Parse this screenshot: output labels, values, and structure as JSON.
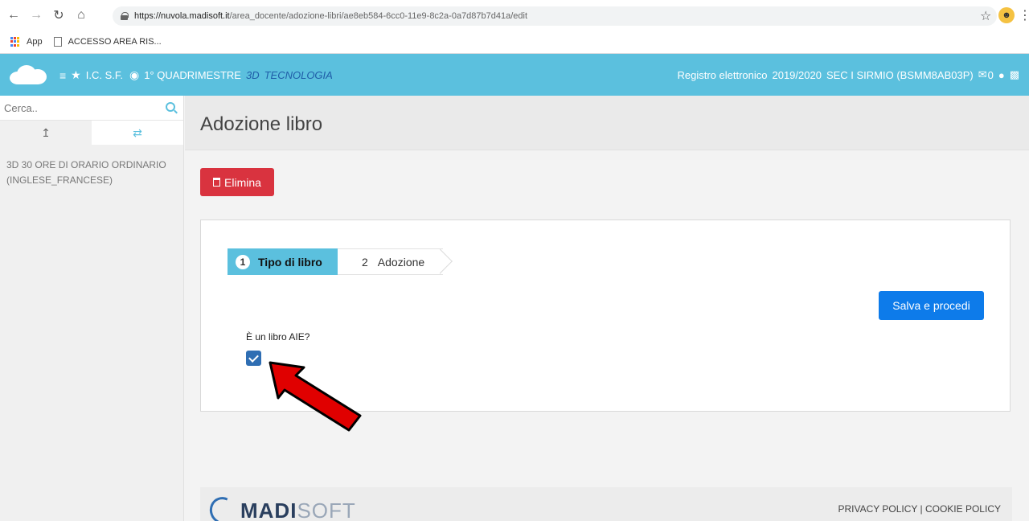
{
  "browser": {
    "url_host": "https://nuvola.madisoft.it",
    "url_path": "/area_docente/adozione-libri/ae8eb584-6cc0-11e9-8c2a-0a7d87b7d41a/edit",
    "bookmarks": [
      "App",
      "ACCESSO AREA RIS..."
    ]
  },
  "header": {
    "school": "I.C. S.F.",
    "period": "1° QUADRIMESTRE",
    "class": "3D",
    "subject": "TECNOLOGIA",
    "registro": "Registro elettronico",
    "year": "2019/2020",
    "sede": "SEC I SIRMIO (BSMM8AB03P)",
    "messages": "0"
  },
  "sidebar": {
    "search_placeholder": "Cerca..",
    "item": "3D 30 ORE DI ORARIO ORDINARIO (INGLESE_FRANCESE)"
  },
  "main": {
    "title": "Adozione libro",
    "delete_label": "Elimina",
    "steps": [
      {
        "num": "1",
        "label": "Tipo di libro"
      },
      {
        "num": "2",
        "label": "Adozione"
      }
    ],
    "save_label": "Salva e procedi",
    "aie_question": "È un libro AIE?"
  },
  "footer": {
    "logo_bold": "MADI",
    "logo_light": "SOFT",
    "links": "PRIVACY POLICY | COOKIE POLICY"
  },
  "colors": {
    "header_bg": "#5bc0de",
    "danger": "#d9333f",
    "primary": "#0d7bea",
    "arrow": "#e00000"
  }
}
